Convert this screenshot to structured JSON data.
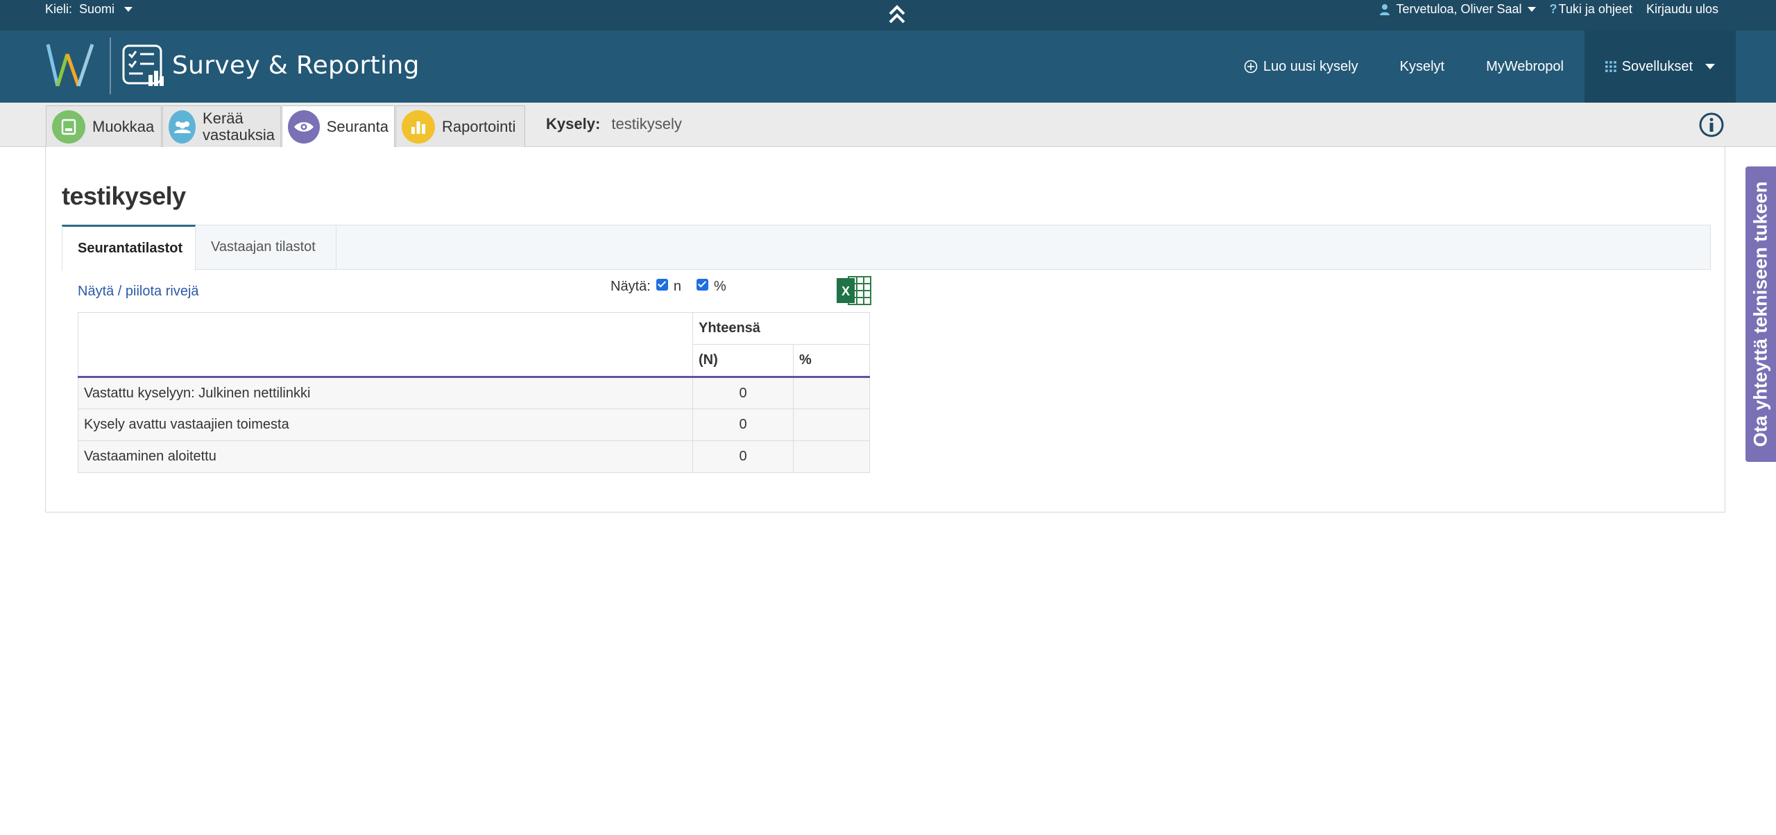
{
  "topbar": {
    "lang_label": "Kieli:",
    "lang_value": "Suomi",
    "user": "Tervetuloa, Oliver Saal",
    "help": "Tuki ja ohjeet",
    "logout": "Kirjaudu ulos"
  },
  "header": {
    "app_title": "Survey & Reporting",
    "nav": {
      "new_survey": "Luo uusi kysely",
      "surveys": "Kyselyt",
      "mywebropol": "MyWebropol",
      "apps": "Sovellukset"
    }
  },
  "subnav": {
    "tabs": [
      {
        "label": "Muokkaa",
        "color": "#7cc06a"
      },
      {
        "label_line1": "Kerää",
        "label_line2": "vastauksia",
        "color": "#5fb3d6"
      },
      {
        "label": "Seuranta",
        "color": "#7a70b5"
      },
      {
        "label": "Raportointi",
        "color": "#f2c12e"
      }
    ],
    "survey_label": "Kysely:",
    "survey_name": "testikysely"
  },
  "main": {
    "title": "testikysely",
    "tabs": [
      "Seurantatilastot",
      "Vastaajan tilastot"
    ],
    "toggle_rows": "Näytä / piilota rivejä",
    "show_label": "Näytä:",
    "show_n": "n",
    "show_pct": "%",
    "show_n_checked": true,
    "show_pct_checked": true,
    "table": {
      "group_header": "Yhteensä",
      "col_n": "(N)",
      "col_pct": "%",
      "rows": [
        {
          "label": "Vastattu kyselyyn: Julkinen nettilinkki",
          "n": "0",
          "pct": ""
        },
        {
          "label": "Kysely avattu vastaajien toimesta",
          "n": "0",
          "pct": ""
        },
        {
          "label": "Vastaaminen aloitettu",
          "n": "0",
          "pct": ""
        }
      ]
    }
  },
  "support_tab": "Ota yhteyttä tekniseen tukeen",
  "colors": {
    "topbar": "#1e4a63",
    "header": "#235876",
    "accent_purple": "#7a70b5",
    "link": "#2b5aa6"
  }
}
